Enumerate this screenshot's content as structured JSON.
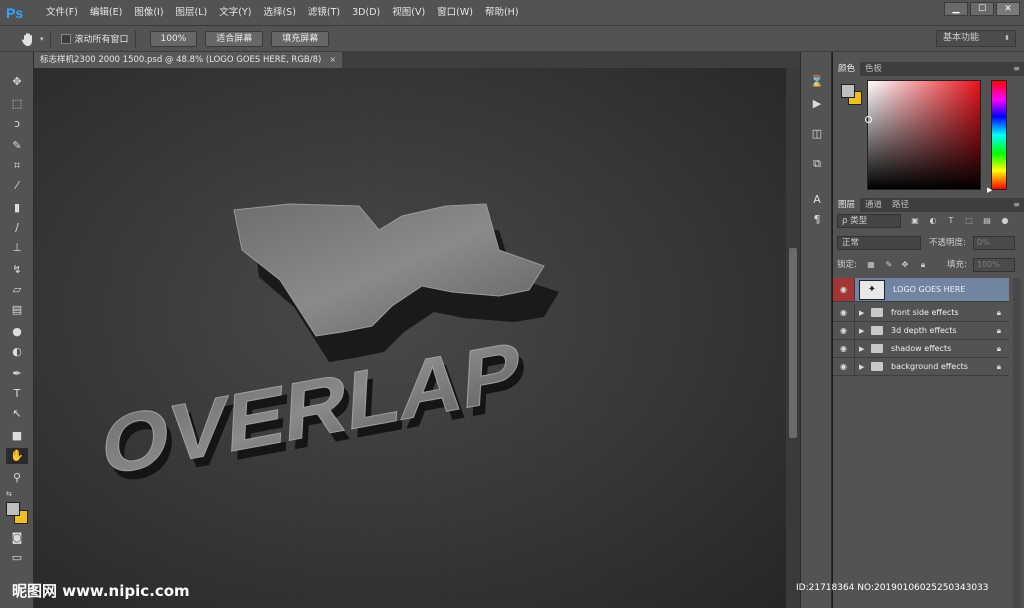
{
  "app": {
    "logo": "Ps"
  },
  "menu": [
    "文件(F)",
    "编辑(E)",
    "图像(I)",
    "图层(L)",
    "文字(Y)",
    "选择(S)",
    "滤镜(T)",
    "3D(D)",
    "视图(V)",
    "窗口(W)",
    "帮助(H)"
  ],
  "window_controls": {
    "minimize": "▁",
    "maximize": "☐",
    "close": "✕"
  },
  "options": {
    "scroll_all_label": "滚动所有窗口",
    "zoom_100": "100%",
    "fit_screen": "适合屏幕",
    "fill_screen": "填充屏幕",
    "workspace": "基本功能"
  },
  "document": {
    "tab_title": "标志样机2300 2000 1500.psd @ 48.8% (LOGO GOES HERE, RGB/8)",
    "close": "×"
  },
  "canvas": {
    "logo_text": "OVERLAP"
  },
  "color_panel": {
    "tabs": [
      "颜色",
      "色板"
    ],
    "foreground": "#bfbfbf",
    "background": "#f0c020"
  },
  "layers_panel": {
    "tabs": [
      "图层",
      "通道",
      "路径"
    ],
    "filter_label": "ρ 类型",
    "blend_mode": "正常",
    "opacity_label": "不透明度:",
    "opacity_value": "0%",
    "lock_label": "锁定:",
    "fill_label": "填充:",
    "fill_value": "100%",
    "layers": [
      {
        "name": "LOGO GOES HERE",
        "type": "smart-object",
        "selected": true
      },
      {
        "name": "front side effects",
        "type": "group",
        "locked": true
      },
      {
        "name": "3d depth effects",
        "type": "group",
        "locked": true
      },
      {
        "name": "shadow effects",
        "type": "group",
        "locked": true
      },
      {
        "name": "background effects",
        "type": "group",
        "locked": true
      }
    ]
  },
  "watermark": {
    "left": "昵图网 www.nipic.com",
    "right": "ID:21718364 NO:20190106025250343033"
  }
}
